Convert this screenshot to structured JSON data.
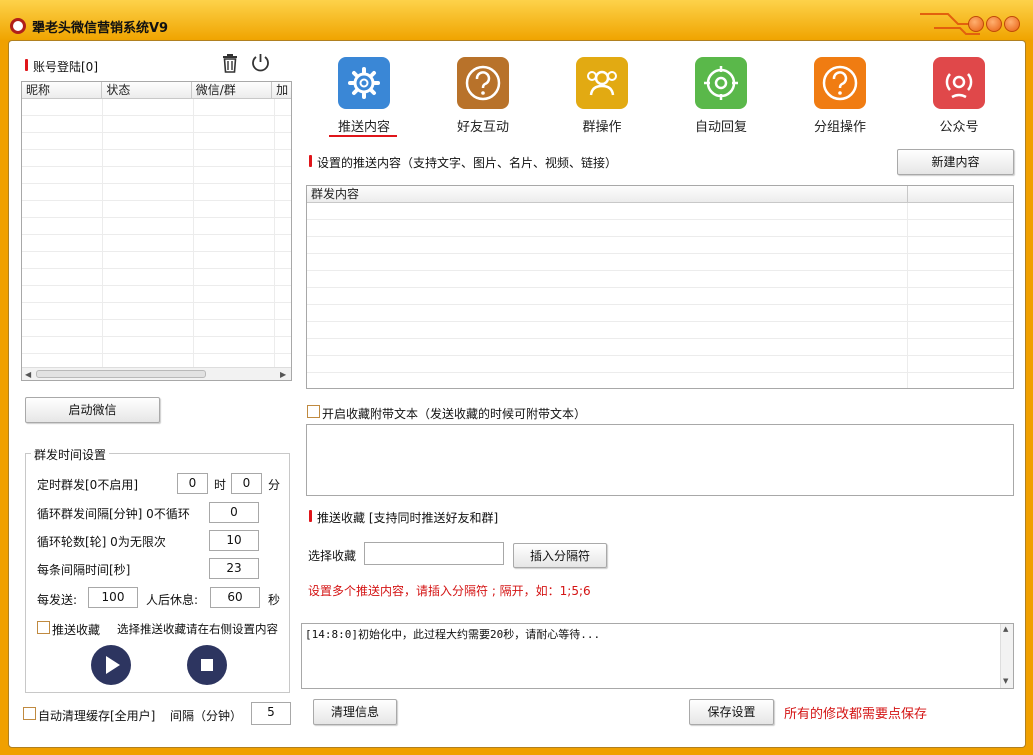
{
  "window": {
    "title": "犟老头微信营销系统V9"
  },
  "colors": {
    "accent_red": "#e0151a",
    "title_orange": "#f0a400",
    "icon_gear": "#3a87d6",
    "icon_friend": "#b8722a",
    "icon_group": "#e2aa12",
    "icon_reply": "#5ab84a",
    "icon_sub": "#f07c12",
    "icon_official": "#e0484a"
  },
  "accounts": {
    "heading": "账号登陆[0]",
    "columns": [
      "昵称",
      "状态",
      "微信/群",
      "加"
    ],
    "start_button": "启动微信"
  },
  "schedule": {
    "legend": "群发时间设置",
    "timed_label": "定时群发[0不启用]",
    "timed_hour": "0",
    "hour_unit": "时",
    "timed_minute": "0",
    "minute_unit": "分",
    "loop_interval_label": "循环群发间隔[分钟] 0不循环",
    "loop_interval": "0",
    "loop_rounds_label": "循环轮数[轮] 0为无限次",
    "loop_rounds": "10",
    "per_item_label": "每条间隔时间[秒]",
    "per_item_interval": "23",
    "send_count_label": "每发送:",
    "send_count": "100",
    "rest_label": "人后休息:",
    "rest_seconds": "60",
    "seconds_unit": "秒",
    "push_fav_label": "推送收藏",
    "push_fav_hint": "选择推送收藏请在右侧设置内容"
  },
  "cache": {
    "auto_clear_label": "自动清理缓存[全用户]",
    "interval_label": "间隔（分钟）",
    "interval_value": "5"
  },
  "nav": {
    "items": [
      {
        "label": "推送内容",
        "icon": "gear-icon",
        "active": true
      },
      {
        "label": "好友互动",
        "icon": "question-icon",
        "active": false
      },
      {
        "label": "群操作",
        "icon": "group-icon",
        "active": false
      },
      {
        "label": "自动回复",
        "icon": "target-icon",
        "active": false
      },
      {
        "label": "分组操作",
        "icon": "question-icon",
        "active": false
      },
      {
        "label": "公众号",
        "icon": "broadcast-icon",
        "active": false
      }
    ]
  },
  "content": {
    "heading": "设置的推送内容（支持文字、图片、名片、视频、链接）",
    "new_button": "新建内容",
    "columns": [
      "群发内容"
    ],
    "attach_text_label": "开启收藏附带文本（发送收藏的时候可附带文本）",
    "fav_heading": "推送收藏 [支持同时推送好友和群]",
    "select_fav_label": "选择收藏",
    "select_fav_value": "",
    "insert_sep_button": "插入分隔符",
    "sep_hint": "设置多个推送内容，请插入分隔符 ; 隔开，如：1;5;6",
    "log_text": "[14:8:0]初始化中，此过程大约需要20秒，请耐心等待...",
    "clear_button": "清理信息",
    "save_button": "保存设置",
    "save_hint": "所有的修改都需要点保存"
  }
}
